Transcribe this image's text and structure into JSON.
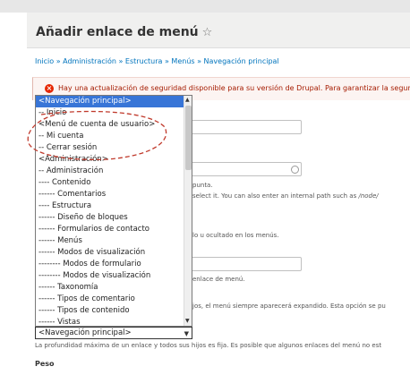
{
  "page": {
    "title": "Añadir enlace de menú",
    "breadcrumb": "Inicio » Administración » Estructura » Menús » Navegación principal"
  },
  "alert": {
    "text": "Hay una actualización de seguridad disponible para su versión de Drupal. Para garantizar la seguri"
  },
  "background_texts": {
    "punta": "punta.",
    "select_it": "select it. You can also enter an internal path such as",
    "path_example": "/node/",
    "ocultado": "lo u ocultado en los menús.",
    "enlace": "enlace de menú.",
    "expandido": "jos, el menú siempre aparecerá expandido. Esta opción se pu"
  },
  "dropdown": {
    "options": [
      "<Navegación principal>",
      "-- Inicio",
      "<Menú de cuenta de usuario>",
      "-- Mi cuenta",
      "-- Cerrar sesión",
      "<Administración>",
      "-- Administración",
      "---- Contenido",
      "------ Comentarios",
      "---- Estructura",
      "------ Diseño de bloques",
      "------ Formularios de contacto",
      "------ Menús",
      "------ Modos de visualización",
      "-------- Modos de formulario",
      "-------- Modos de visualización",
      "------ Taxonomía",
      "------ Tipos de comentario",
      "------ Tipos de contenido",
      "------ Vistas"
    ],
    "selected_index": 0,
    "selected_value": "<Navegación principal>"
  },
  "description": "La profundidad máxima de un enlace y todos sus hijos es fija. Es posible que algunos enlaces del menú no est",
  "weight_label": "Peso",
  "colors": {
    "highlight": "#3875d7",
    "link": "#0074bd",
    "alert_text": "#a51b00",
    "annotation": "#c0392b"
  }
}
